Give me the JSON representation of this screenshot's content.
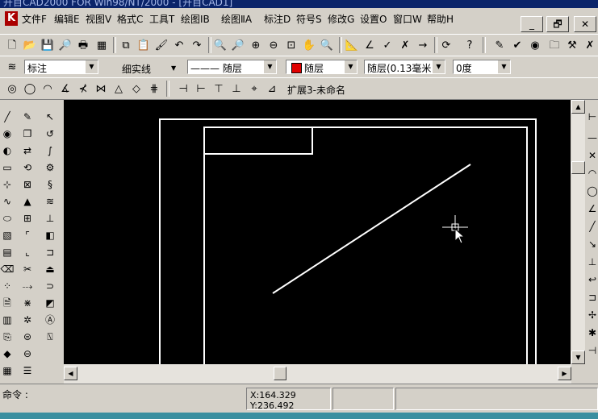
{
  "title": {
    "text": "开目CAD2000 FOR Win98/NT/2000 - [开目CAD1]"
  },
  "menu": [
    "文件F",
    "编辑E",
    "视图V",
    "格式C",
    "工具T",
    "绘图ⅠB",
    "绘图ⅡA",
    "标注D",
    "符号S",
    "修改G",
    "设置O",
    "窗口W",
    "帮助H"
  ],
  "window_controls": {
    "minimize": "_",
    "restore": "🗗",
    "close": "✕"
  },
  "toolbar2": {
    "style_combo": "标注",
    "line_label": "细实线",
    "linetype_combo": "——— 随层",
    "color_combo": "随层",
    "lineweight_combo": "随层(0.13毫米)",
    "angle_combo": "0度",
    "colors": {
      "layer_color": "#e00000"
    }
  },
  "toolbar3": {
    "extend_label": "扩展3-未命名"
  },
  "canvas": {
    "background": "#000000",
    "line_color": "#ffffff"
  },
  "status": {
    "command_label": "命令 :",
    "x": "X:164.329",
    "y": "Y:236.492"
  },
  "icons": {
    "toolbar1": [
      "new-file-icon",
      "open-file-icon",
      "save-icon",
      "print-preview-icon",
      "print-icon",
      "copy-icon",
      "paste-icon",
      "match-properties-icon",
      "undo-icon",
      "redo-icon",
      "zoom-window-icon",
      "zoom-realtime-icon",
      "zoom-in-icon",
      "zoom-out-icon",
      "zoom-extents-icon",
      "pan-hand-icon",
      "zoom-previous-icon",
      "measure-icon",
      "angle-icon",
      "check-icon",
      "arrow-tool-icon",
      "refresh-icon",
      "help-icon",
      "pen-icon",
      "mark-icon",
      "globe-icon",
      "folder-icon",
      "tool-icon"
    ],
    "toolbar3": [
      "circle-icon",
      "circle-2-icon",
      "arc-icon",
      "angle-dim-icon",
      "dim-tool-icon",
      "dim-tool-2-icon",
      "triangle-icon",
      "diamond-icon",
      "grid-icon",
      "dim-h-icon",
      "dim-h2-icon",
      "dim-h3-icon",
      "dim-h4-icon",
      "special-icon",
      "delta-icon"
    ]
  }
}
